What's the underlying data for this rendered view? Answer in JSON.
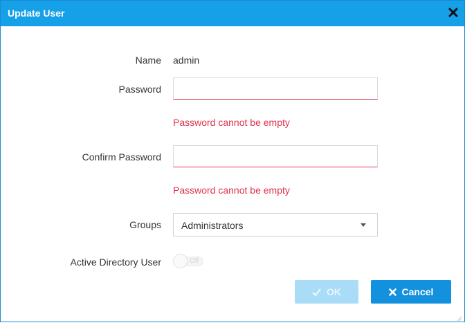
{
  "dialog": {
    "title": "Update User",
    "close_icon": "close-icon"
  },
  "form": {
    "name": {
      "label": "Name",
      "value": "admin"
    },
    "password": {
      "label": "Password",
      "value": "",
      "error": "Password cannot be empty"
    },
    "confirm_password": {
      "label": "Confirm Password",
      "value": "",
      "error": "Password cannot be empty"
    },
    "groups": {
      "label": "Groups",
      "selected": "Administrators",
      "icon": "chevron-down-icon"
    },
    "active_directory": {
      "label": "Active Directory User",
      "toggle_text": "Off",
      "state": "off"
    }
  },
  "buttons": {
    "ok_label": "OK",
    "ok_icon": "check-icon",
    "cancel_label": "Cancel",
    "cancel_icon": "close-icon"
  },
  "colors": {
    "header": "#16a0e8",
    "error": "#e0314c",
    "cancel_button": "#1491de",
    "ok_button_disabled": "#a9dcf7"
  }
}
